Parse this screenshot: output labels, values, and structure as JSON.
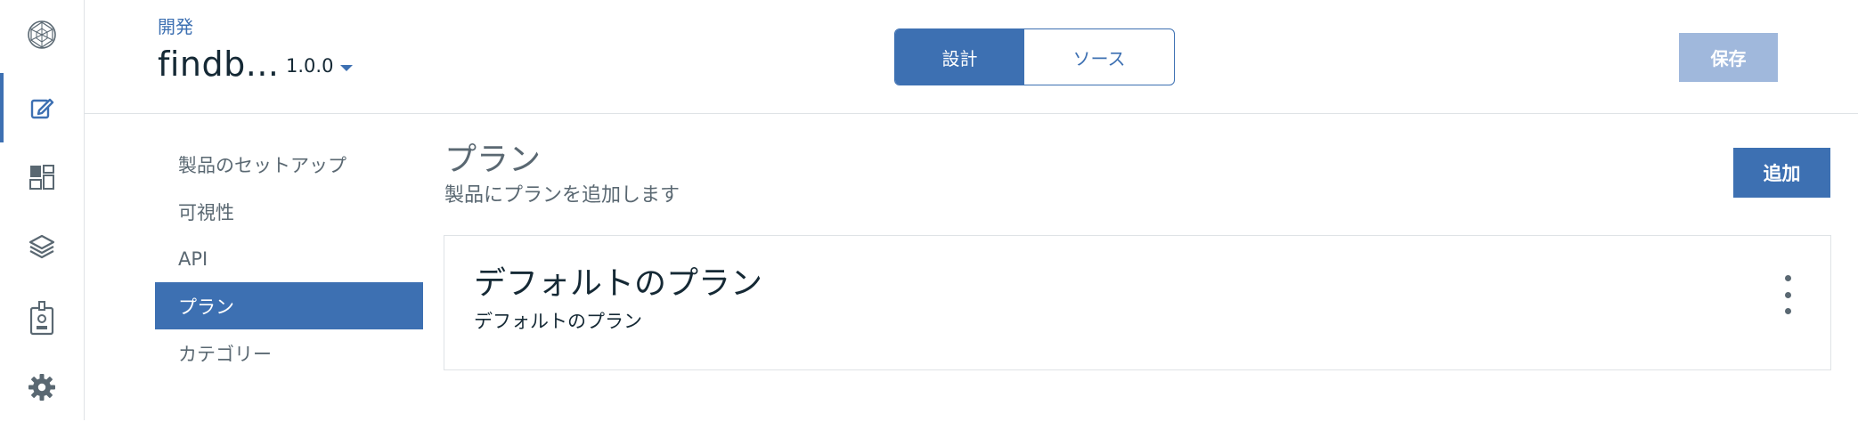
{
  "rail": {
    "items": [
      {
        "icon": "network-logo-icon"
      },
      {
        "icon": "develop-edit-icon",
        "active": true
      },
      {
        "icon": "dashboard-icon"
      },
      {
        "icon": "layers-icon"
      },
      {
        "icon": "id-badge-icon"
      },
      {
        "icon": "gear-icon"
      }
    ]
  },
  "header": {
    "breadcrumb": "開発",
    "product_title": "findb...",
    "version": "1.0.0",
    "view_toggle": {
      "design_label": "設計",
      "source_label": "ソース",
      "selected": "design"
    },
    "save_label": "保存"
  },
  "subnav": {
    "items": [
      {
        "label": "製品のセットアップ",
        "active": false
      },
      {
        "label": "可視性",
        "active": false
      },
      {
        "label": "API",
        "active": false
      },
      {
        "label": "プラン",
        "active": true
      },
      {
        "label": "カテゴリー",
        "active": false
      }
    ]
  },
  "main": {
    "title": "プラン",
    "subtitle": "製品にプランを追加します",
    "add_label": "追加",
    "plans": [
      {
        "name": "デフォルトのプラン",
        "description": "デフォルトのプラン"
      }
    ]
  },
  "colors": {
    "accent": "#3d70b2",
    "save_disabled": "#a0b8dc",
    "border": "#dfe3e6",
    "muted_text": "#5a6872"
  }
}
